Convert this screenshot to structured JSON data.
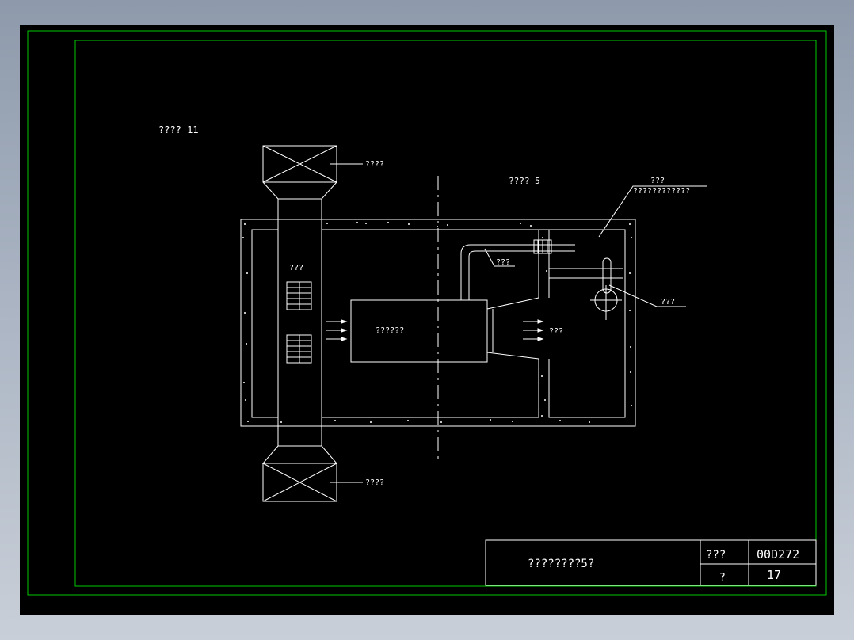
{
  "colors": {
    "background_gradient_top": "#8e9aab",
    "background_gradient_bottom": "#c9cfd8",
    "canvas": "#000000",
    "frame": "#00c800",
    "lines": "#ffffff"
  },
  "drawing": {
    "label_top_left": "???? 11",
    "label_top_center": "???? 5",
    "label_top_fan_callout": "????",
    "label_bottom_fan_callout": "????",
    "label_duct": "???",
    "label_equipment": "??????",
    "label_flow": "???",
    "label_pipe": "???",
    "label_valve": "???",
    "label_top_right_1": "???",
    "label_top_right_2": "????????????"
  },
  "title_block": {
    "title": "????????5?",
    "field1_label": "???",
    "field1_value": "00D272",
    "field2_label": "?",
    "field2_value": "17"
  }
}
